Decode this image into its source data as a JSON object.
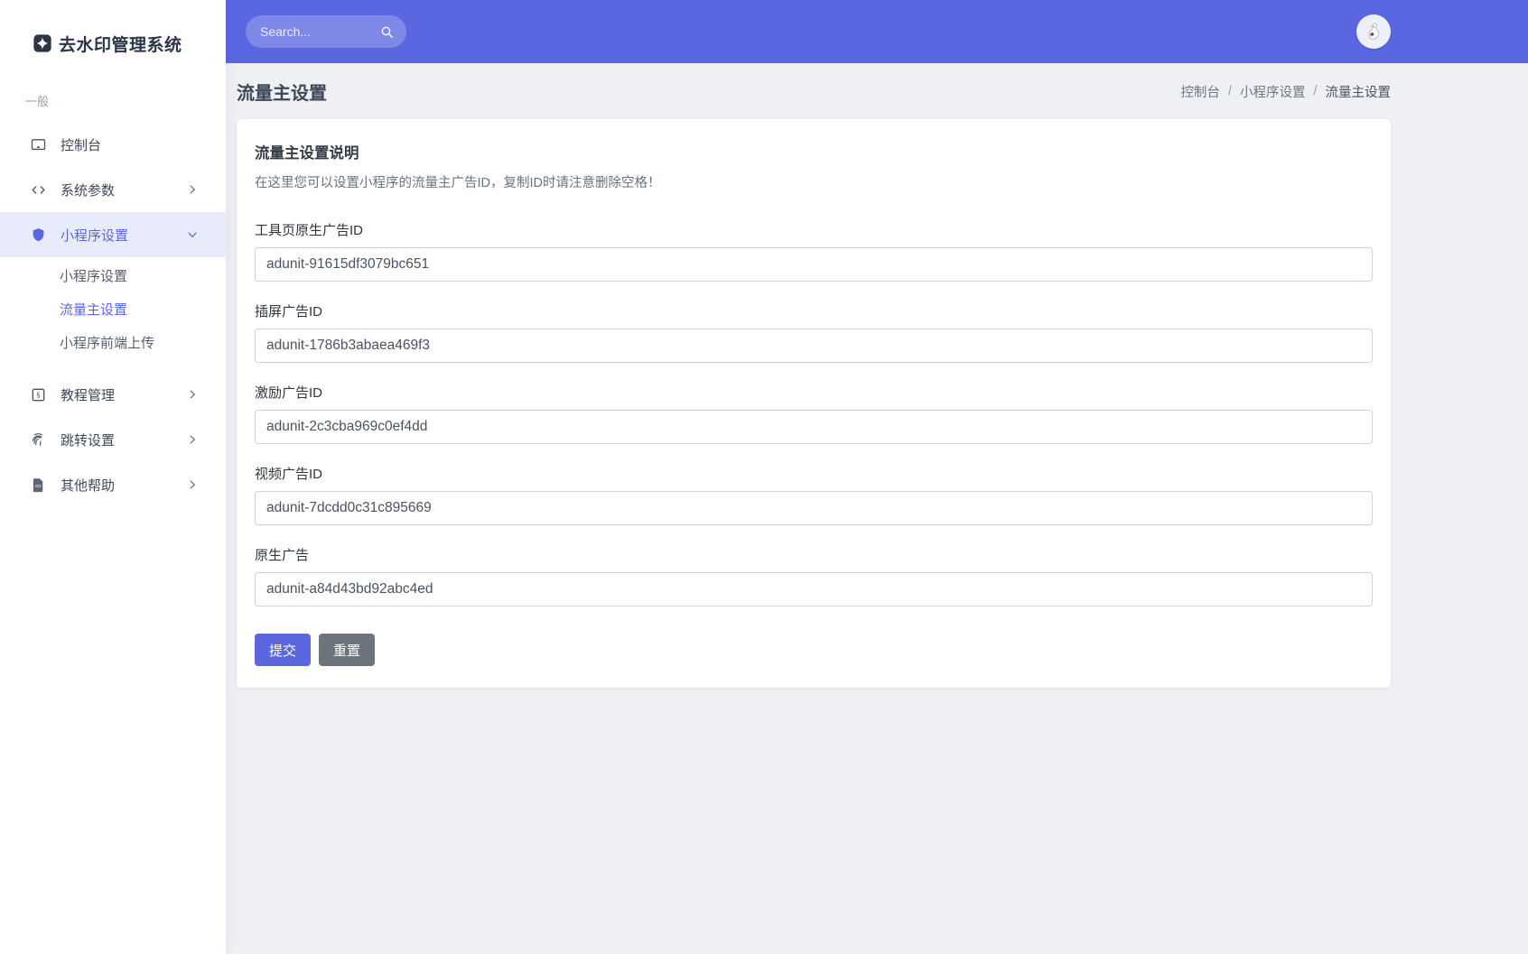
{
  "app": {
    "title": "去水印管理系统",
    "logo_icon": "sparkle-badge"
  },
  "topbar": {
    "search_placeholder": "Search...",
    "search_icon": "magnifier",
    "avatar_icon": "goose-cartoon"
  },
  "sidebar": {
    "section_label": "一般",
    "items": [
      {
        "label": "控制台",
        "icon": "monitor",
        "chevron": "none",
        "active": false
      },
      {
        "label": "系统参数",
        "icon": "code",
        "chevron": "right",
        "active": false
      },
      {
        "label": "小程序设置",
        "icon": "shield",
        "chevron": "down",
        "active": true,
        "children": [
          {
            "label": "小程序设置",
            "active": false
          },
          {
            "label": "流量主设置",
            "active": true
          },
          {
            "label": "小程序前端上传",
            "active": false
          }
        ]
      },
      {
        "label": "教程管理",
        "icon": "license-square",
        "chevron": "right",
        "active": false
      },
      {
        "label": "跳转设置",
        "icon": "fingerprint",
        "chevron": "right",
        "active": false
      },
      {
        "label": "其他帮助",
        "icon": "file-code",
        "chevron": "right",
        "active": false
      }
    ]
  },
  "page": {
    "title": "流量主设置",
    "breadcrumb": [
      "控制台",
      "小程序设置",
      "流量主设置"
    ],
    "crumb_sep": "/"
  },
  "card": {
    "title": "流量主设置说明",
    "description": "在这里您可以设置小程序的流量主广告ID，复制ID时请注意删除空格！",
    "fields": [
      {
        "label": "工具页原生广告ID",
        "value": "adunit-91615df3079bc651"
      },
      {
        "label": "插屏广告ID",
        "value": "adunit-1786b3abaea469f3"
      },
      {
        "label": "激励广告ID",
        "value": "adunit-2c3cba969c0ef4dd"
      },
      {
        "label": "视频广告ID",
        "value": "adunit-7dcdd0c31c895669"
      },
      {
        "label": "原生广告",
        "value": "adunit-a84d43bd92abc4ed"
      }
    ],
    "buttons": {
      "submit": "提交",
      "reset": "重置"
    }
  },
  "colors": {
    "accent": "#5a67e0",
    "accent-dark": "#5a67dd",
    "sidebar-active-bg": "#e8ebfa",
    "content-bg": "#eef0f4",
    "reset-gray": "#6c757d"
  }
}
